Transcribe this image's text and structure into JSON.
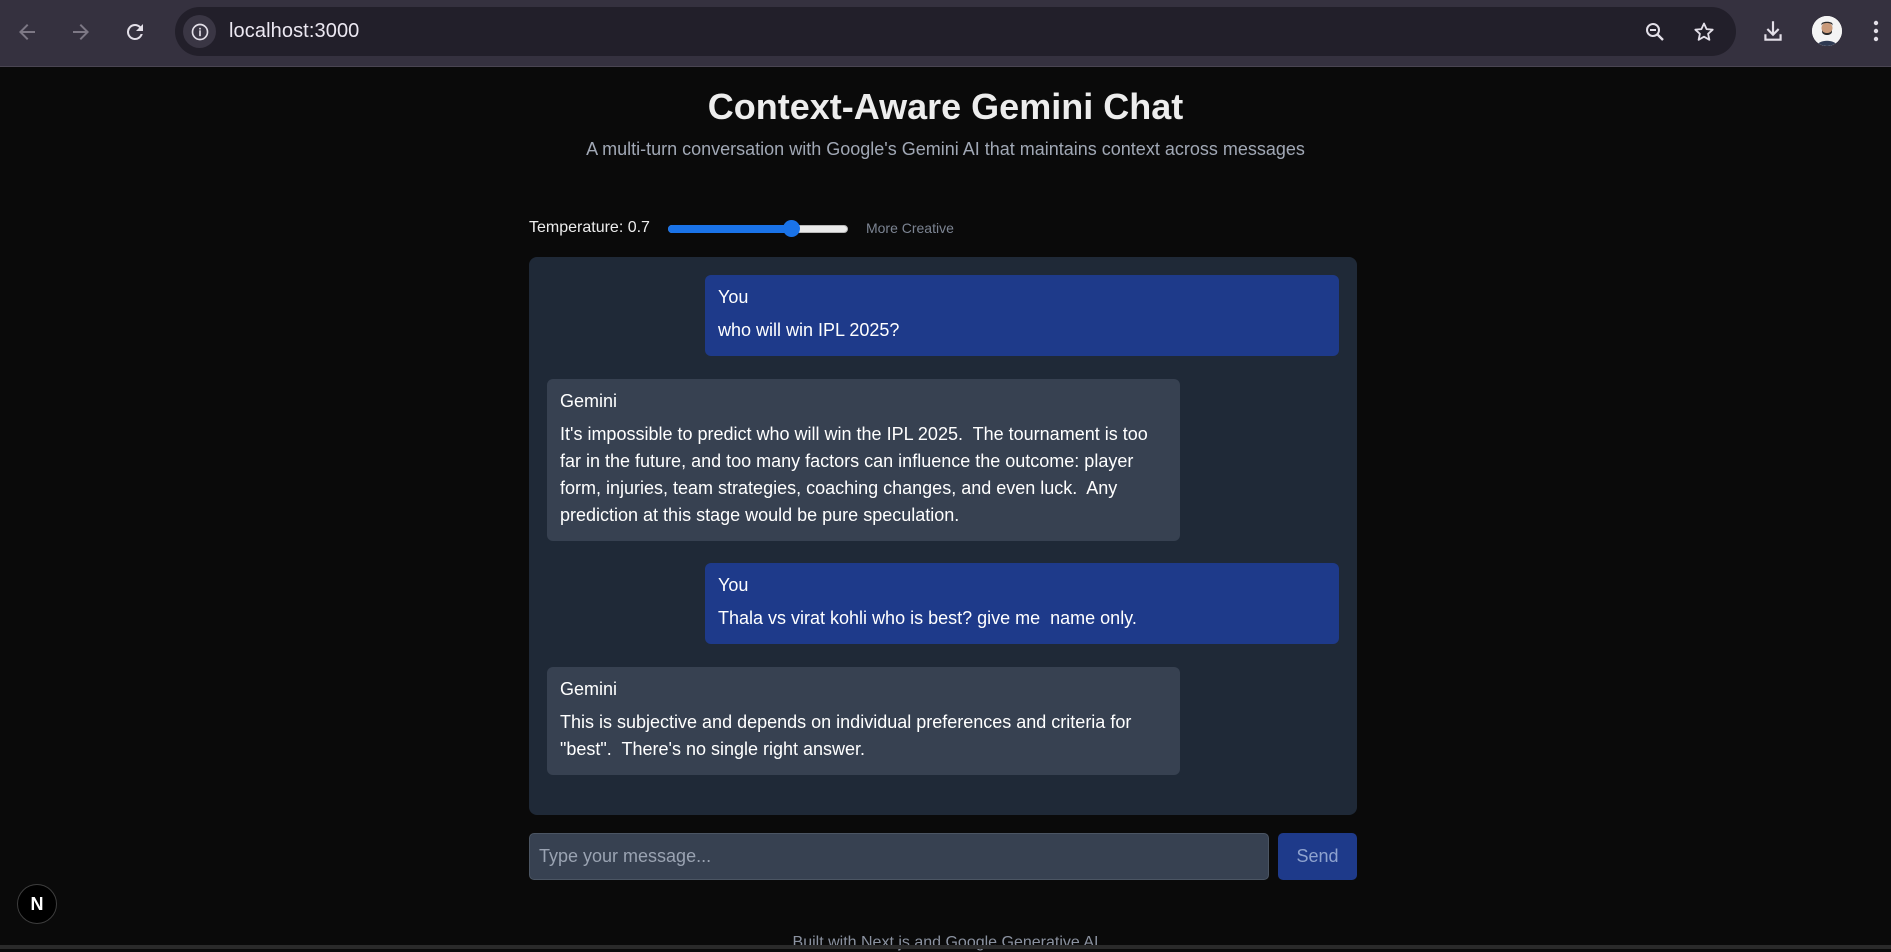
{
  "browser": {
    "url": "localhost:3000",
    "icons": {
      "back": "arrow-left-icon",
      "forward": "arrow-right-icon",
      "reload": "reload-icon",
      "info": "info-icon",
      "zoom": "zoom-out-icon",
      "bookmark": "star-icon",
      "downloads": "download-icon",
      "profile": "avatar",
      "menu": "kebab-menu-icon"
    }
  },
  "header": {
    "title": "Context-Aware Gemini Chat",
    "subtitle": "A multi-turn conversation with Google's Gemini AI that maintains context across messages"
  },
  "temperature": {
    "label": "Temperature: 0.7",
    "value": 0.7,
    "min": 0,
    "max": 1,
    "hint": "More Creative"
  },
  "messages": [
    {
      "role": "user",
      "sender": "You",
      "text": "who will win IPL 2025?"
    },
    {
      "role": "ai",
      "sender": "Gemini",
      "text": "It's impossible to predict who will win the IPL 2025.  The tournament is too far in the future, and too many factors can influence the outcome: player form, injuries, team strategies, coaching changes, and even luck.  Any prediction at this stage would be pure speculation."
    },
    {
      "role": "user",
      "sender": "You",
      "text": "Thala vs virat kohli who is best? give me  name only."
    },
    {
      "role": "ai",
      "sender": "Gemini",
      "text": "This is subjective and depends on individual preferences and criteria for \"best\".  There's no single right answer."
    }
  ],
  "composer": {
    "placeholder": "Type your message...",
    "value": "",
    "send_label": "Send"
  },
  "footer": {
    "text": "Built with Next.js and Google Generative AI"
  },
  "dev_badge": {
    "label": "N"
  },
  "colors": {
    "user_bubble": "#1e3a8a",
    "ai_bubble": "#374151",
    "panel": "#1f2937",
    "accent": "#1a73e8"
  }
}
